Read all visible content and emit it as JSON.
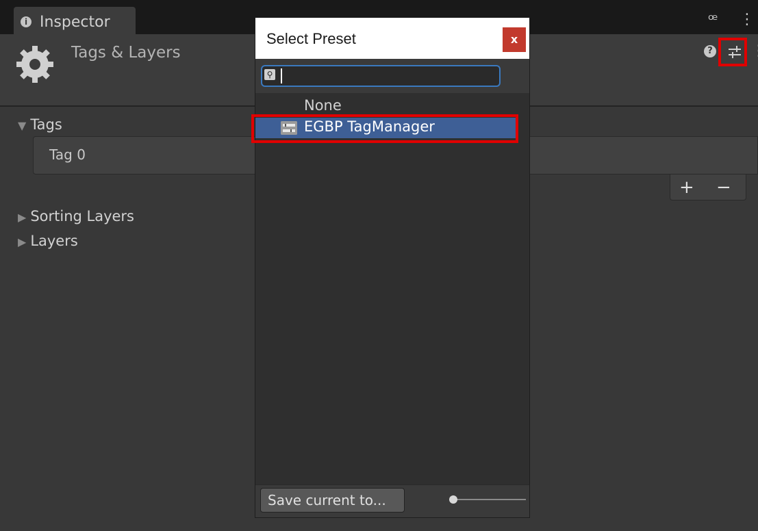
{
  "window": {
    "tab_label": "Inspector",
    "icons": [
      "info-icon",
      "lock-icon",
      "more-vertical-icon"
    ]
  },
  "header": {
    "title": "Tags & Layers",
    "icons": [
      "gear-icon",
      "help-icon",
      "preset-settings-icon",
      "more-vertical-icon"
    ]
  },
  "inspector": {
    "tags_label": "Tags",
    "tag_items": [
      "Tag 0"
    ],
    "add_label": "+",
    "remove_label": "−",
    "sorting_layers_label": "Sorting Layers",
    "layers_label": "Layers"
  },
  "preset_dialog": {
    "title": "Select Preset",
    "close_label": "x",
    "search": {
      "value": "",
      "placeholder": ""
    },
    "items": [
      {
        "label": "None",
        "selected": false
      },
      {
        "label": "EGBP TagManager",
        "selected": true
      }
    ],
    "save_label": "Save current to...",
    "size_slider": 0.0
  },
  "annotations": {
    "highlight_color": "#e00000"
  },
  "colors": {
    "background": "#383838",
    "selection": "#3e5f96",
    "search_focus": "#3a79bf",
    "close_button": "#c23a2d"
  }
}
